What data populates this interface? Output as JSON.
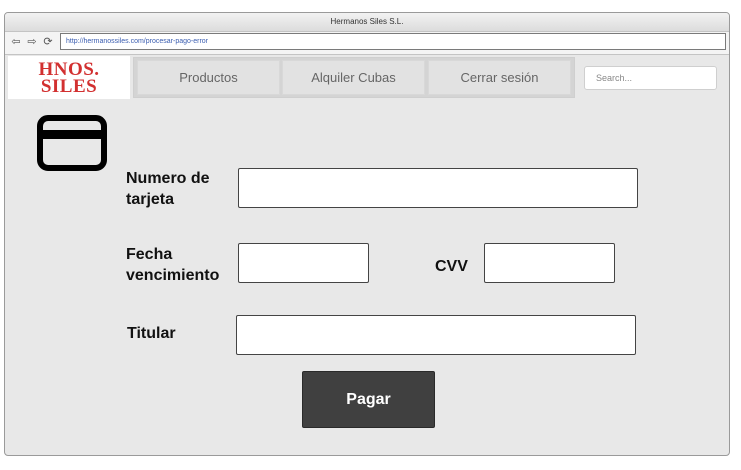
{
  "window": {
    "title": "Hermanos Siles S.L."
  },
  "addressbar": {
    "url": "http://hermanossiles.com/procesar-pago-error"
  },
  "logo": {
    "line1": "HNOS.",
    "line2": "SILES"
  },
  "nav": {
    "tabs": [
      {
        "label": "Productos"
      },
      {
        "label": "Alquiler Cubas"
      },
      {
        "label": "Cerrar sesión"
      }
    ],
    "search_placeholder": "Search..."
  },
  "form": {
    "card_number_label_line1": "Numero de",
    "card_number_label_line2": "tarjeta",
    "expiry_label_line1": "Fecha",
    "expiry_label_line2": "vencimiento",
    "cvv_label": "CVV",
    "holder_label": "Titular",
    "card_number_value": "",
    "expiry_value": "",
    "cvv_value": "",
    "holder_value": "",
    "pay_label": "Pagar"
  },
  "icons": {
    "back": "arrow-left-icon",
    "forward": "arrow-right-icon",
    "reload": "reload-icon",
    "card": "credit-card-icon"
  }
}
